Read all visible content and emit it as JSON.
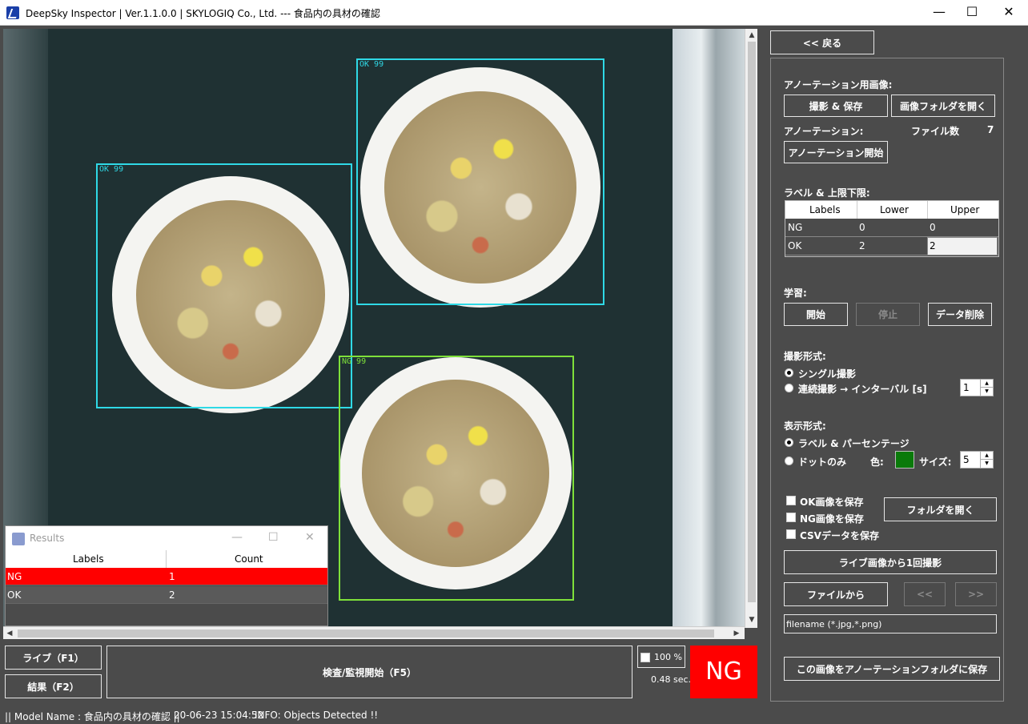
{
  "window": {
    "title": "DeepSky Inspector | Ver.1.1.0.0 | SKYLOGIQ Co., Ltd. --- 食品内の具材の確認",
    "minimize": "—",
    "maximize": "☐",
    "close": "✕"
  },
  "detections": [
    {
      "label": "OK 99",
      "status": "OK"
    },
    {
      "label": "OK 99",
      "status": "OK"
    },
    {
      "label": "NG 99",
      "status": "NG"
    }
  ],
  "results_window": {
    "title": "Results",
    "headers": [
      "Labels",
      "Count"
    ],
    "rows": [
      {
        "label": "NG",
        "count": "1"
      },
      {
        "label": "OK",
        "count": "2"
      }
    ]
  },
  "bottom": {
    "live_button": "ライブ（F1）",
    "results_button": "結果（F2）",
    "inspect_button": "検査/監視開始（F5）",
    "zoom_checkbox": "100 %",
    "elapsed": "0.48 sec.",
    "judgement": "NG"
  },
  "panel": {
    "back_button": "<< 戻る",
    "annotation_image_label": "アノーテーション用画像:",
    "capture_save_button": "撮影 & 保存",
    "open_image_folder_button": "画像フォルダを開く",
    "annotation_label": "アノーテーション:",
    "file_count_label": "ファイル数",
    "file_count_value": "7",
    "annotation_start_button": "アノーテーション開始",
    "label_limits_title": "ラベル & 上限下限:",
    "limits_headers": [
      "Labels",
      "Lower",
      "Upper"
    ],
    "limits_rows": [
      {
        "label": "NG",
        "lower": "0",
        "upper": "0"
      },
      {
        "label": "OK",
        "lower": "2",
        "upper": "2"
      }
    ],
    "learning_label": "学習:",
    "start_button": "開始",
    "stop_button": "停止",
    "delete_data_button": "データ削除",
    "capture_mode_label": "撮影形式:",
    "single_capture": "シングル撮影",
    "continuous_capture": "連続撮影 → インターバル [s]",
    "interval_value": "1",
    "display_mode_label": "表示形式:",
    "label_percentage": "ラベル & パーセンテージ",
    "dots_only": "ドットのみ",
    "color_label": "色:",
    "dot_color": "#0a7a0a",
    "size_label": "サイズ:",
    "size_value": "5",
    "save_ok": "OK画像を保存",
    "save_ng": "NG画像を保存",
    "save_csv": "CSVデータを保存",
    "open_folder_button": "フォルダを開く",
    "capture_once_button": "ライブ画像から1回撮影",
    "from_file_button": "ファイルから",
    "prev_button": "<<",
    "next_button": ">>",
    "filename_placeholder": "filename (*.jpg,*.png)",
    "save_to_annotation_button": "この画像をアノーテーションフォルダに保存"
  },
  "status": {
    "model": "|| Model Name : 食品内の具材の確認 ||",
    "timestamp": "20-06-23 15:04:52",
    "info": "INFO:   Objects Detected !!"
  }
}
